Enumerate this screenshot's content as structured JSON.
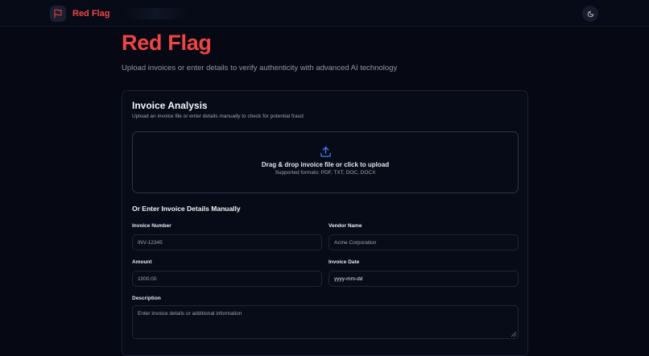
{
  "header": {
    "brand_name": "Red Flag",
    "brand_icon": "flag-icon",
    "theme_icon": "moon-icon",
    "accent_color": "#ef4444"
  },
  "hero": {
    "title": "Red Flag",
    "subtitle": "Upload invoices or enter details to verify authenticity with advanced AI technology"
  },
  "card": {
    "title": "Invoice Analysis",
    "description": "Upload an invoice file or enter details manually to check for potential fraud",
    "dropzone": {
      "icon": "upload-icon",
      "title": "Drag & drop invoice file or click to upload",
      "formats": "Supported formats: PDF, TXT, DOC, DOCX"
    },
    "manual_title": "Or Enter Invoice Details Manually",
    "fields": {
      "invoice_number": {
        "label": "Invoice Number",
        "placeholder": "INV-12345"
      },
      "vendor_name": {
        "label": "Vendor Name",
        "placeholder": "Acme Corporation"
      },
      "amount": {
        "label": "Amount",
        "placeholder": "1000.00"
      },
      "invoice_date": {
        "label": "Invoice Date",
        "placeholder": "yyyy-mm-dd"
      },
      "description": {
        "label": "Description",
        "placeholder": "Enter invoice details or additional information"
      }
    }
  }
}
